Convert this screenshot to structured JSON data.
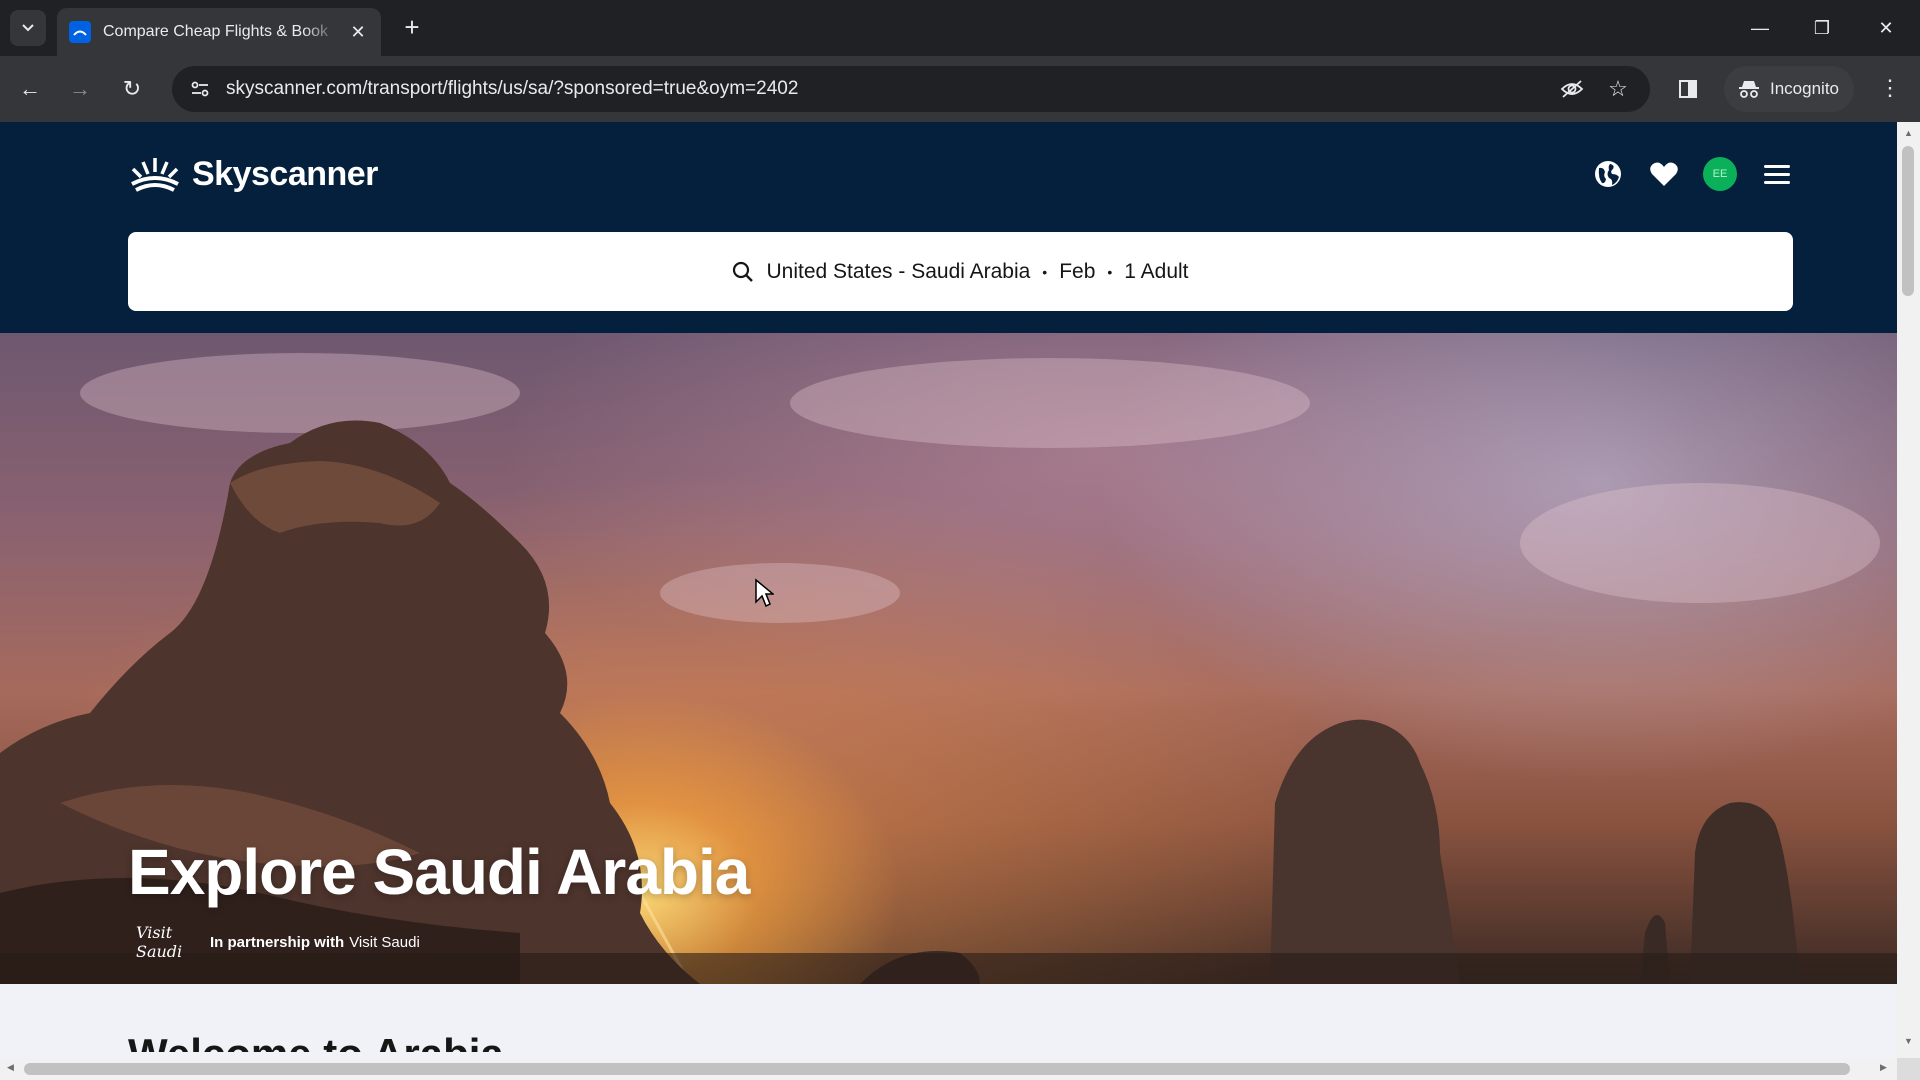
{
  "browser": {
    "tab": {
      "title": "Compare Cheap Flights & Book",
      "close_icon": "close-icon"
    },
    "url": "skyscanner.com/transport/flights/us/sa/?sponsored=true&oym=2402",
    "incognito_label": "Incognito",
    "window_controls": [
      "minimize",
      "restore",
      "close"
    ]
  },
  "header": {
    "logo_text": "Skyscanner",
    "icons": [
      "globe-icon",
      "heart-icon",
      "avatar",
      "menu-icon"
    ],
    "avatar_initials": "EE",
    "avatar_color": "#0ab15a",
    "brand_color": "#05203c"
  },
  "search": {
    "route": "United States - Saudi Arabia",
    "separator": "•",
    "month": "Feb",
    "travellers": "1 Adult"
  },
  "hero": {
    "title": "Explore Saudi Arabia",
    "partner_logo_text": "Visit Saudi",
    "partner_prefix": "In partnership with",
    "partner_name": "Visit Saudi"
  },
  "content": {
    "welcome_heading": "Welcome to Arabia"
  }
}
